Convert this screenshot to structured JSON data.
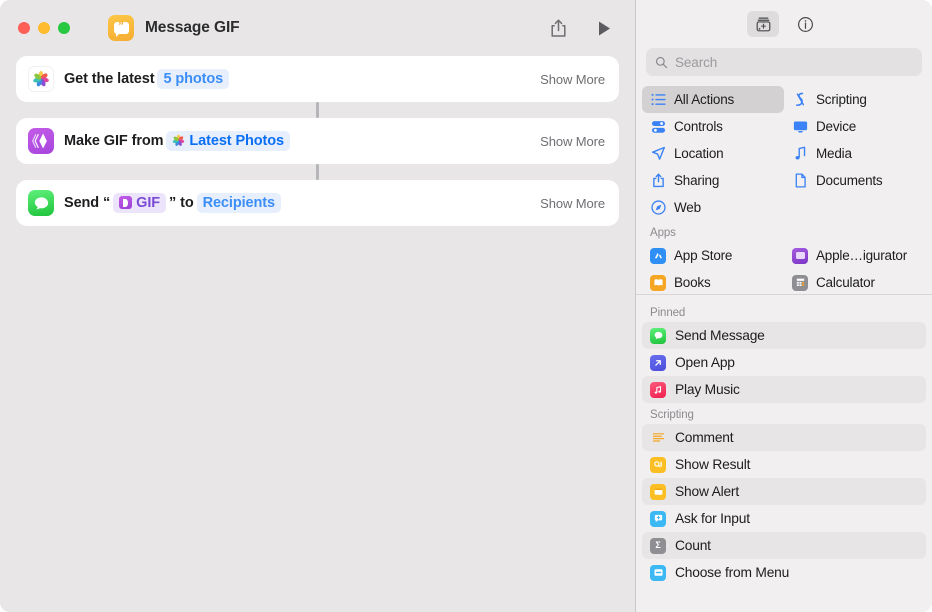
{
  "window": {
    "title": "Message GIF",
    "app_icon": "messages-shortcut-icon",
    "traffic_lights": [
      "close",
      "minimize",
      "zoom"
    ],
    "toolbar": {
      "share_label": "share-icon",
      "run_label": "play-icon"
    }
  },
  "editor": {
    "actions": [
      {
        "icon": "photos-icon",
        "prefix": "Get the latest",
        "tokens": [
          {
            "text": "5 photos",
            "style": "plain"
          }
        ],
        "suffix": "",
        "show_more": "Show More"
      },
      {
        "icon": "make-gif-icon",
        "prefix": "Make GIF from",
        "tokens": [
          {
            "text": "Latest Photos",
            "style": "photos",
            "mini_icon": "photos-mini-icon"
          }
        ],
        "suffix": "",
        "show_more": "Show More"
      },
      {
        "icon": "messages-icon",
        "prefix": "Send “",
        "tokens": [
          {
            "text": "GIF",
            "style": "purple",
            "mini_icon": "gif-mini-icon"
          }
        ],
        "mid": "” to",
        "tokens2": [
          {
            "text": "Recipients",
            "style": "plain"
          }
        ],
        "show_more": "Show More"
      }
    ]
  },
  "library": {
    "toolbar": {
      "actions_tab": "action-library-icon",
      "info_tab": "info-icon"
    },
    "search": {
      "placeholder": "Search",
      "value": "",
      "icon": "search-icon"
    },
    "categories": [
      {
        "label": "All Actions",
        "icon": "list-icon",
        "selected": true
      },
      {
        "label": "Scripting",
        "icon": "scripting-icon",
        "selected": false
      },
      {
        "label": "Controls",
        "icon": "controls-icon",
        "selected": false
      },
      {
        "label": "Device",
        "icon": "device-icon",
        "selected": false
      },
      {
        "label": "Location",
        "icon": "location-icon",
        "selected": false
      },
      {
        "label": "Media",
        "icon": "media-icon",
        "selected": false
      },
      {
        "label": "Sharing",
        "icon": "sharing-icon",
        "selected": false
      },
      {
        "label": "Documents",
        "icon": "documents-icon",
        "selected": false
      },
      {
        "label": "Web",
        "icon": "web-icon",
        "selected": false
      }
    ],
    "apps_section": {
      "header": "Apps",
      "items": [
        {
          "label": "App Store",
          "icon": "app-store-icon"
        },
        {
          "label": "Apple…igurator",
          "icon": "apple-configurator-icon"
        },
        {
          "label": "Books",
          "icon": "books-icon"
        },
        {
          "label": "Calculator",
          "icon": "calculator-icon"
        }
      ]
    },
    "pinned_section": {
      "header": "Pinned",
      "items": [
        {
          "label": "Send Message",
          "icon": "messages-icon"
        },
        {
          "label": "Open App",
          "icon": "open-app-icon"
        },
        {
          "label": "Play Music",
          "icon": "music-icon"
        }
      ]
    },
    "scripting_section": {
      "header": "Scripting",
      "items": [
        {
          "label": "Comment",
          "icon": "comment-icon"
        },
        {
          "label": "Show Result",
          "icon": "show-result-icon"
        },
        {
          "label": "Show Alert",
          "icon": "show-alert-icon"
        },
        {
          "label": "Ask for Input",
          "icon": "ask-input-icon"
        },
        {
          "label": "Count",
          "icon": "count-icon"
        },
        {
          "label": "Choose from Menu",
          "icon": "choose-menu-icon"
        }
      ]
    }
  },
  "colors": {
    "accent_blue": "#0a6ff5",
    "window_bg": "#e8e6e6",
    "sidebar_bg": "#f1efef",
    "card_bg": "#ffffff"
  }
}
